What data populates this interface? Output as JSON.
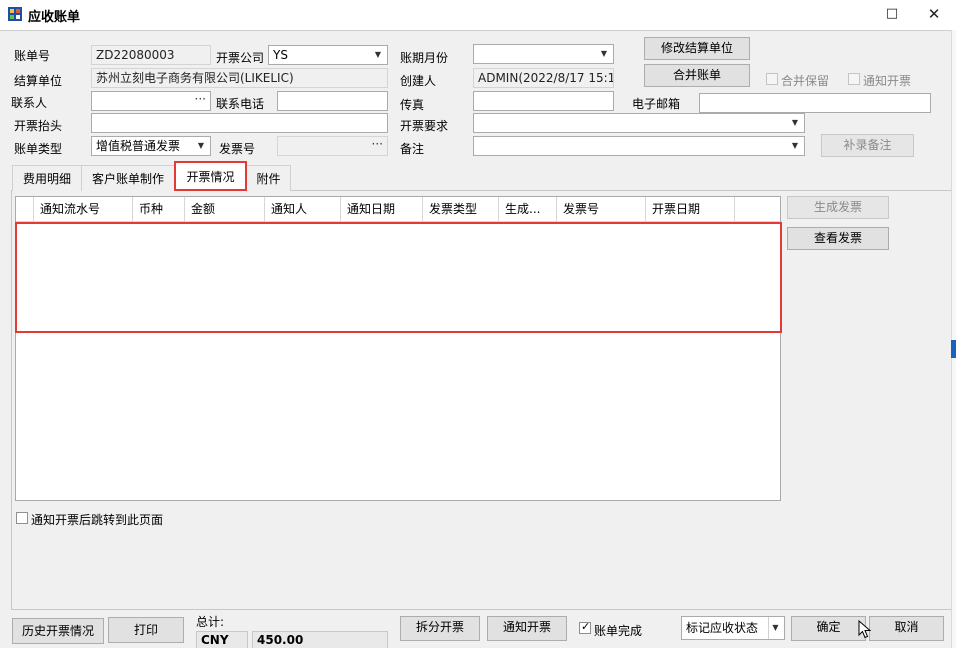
{
  "window": {
    "title": "应收账单",
    "maximize_icon": "□",
    "close_icon": "✕"
  },
  "form": {
    "bill_no": {
      "label": "账单号",
      "value": "ZD22080003"
    },
    "invoice_company": {
      "label": "开票公司",
      "value": "YS"
    },
    "period_month": {
      "label": "账期月份",
      "value": ""
    },
    "settle_unit": {
      "label": "结算单位",
      "value": "苏州立刻电子商务有限公司(LIKELIC)"
    },
    "creator": {
      "label": "创建人",
      "value": "ADMIN(2022/8/17 15:1"
    },
    "contact": {
      "label": "联系人",
      "value": ""
    },
    "phone": {
      "label": "联系电话",
      "value": ""
    },
    "fax": {
      "label": "传真",
      "value": ""
    },
    "email": {
      "label": "电子邮箱",
      "value": ""
    },
    "invoice_header": {
      "label": "开票抬头",
      "value": ""
    },
    "invoice_req": {
      "label": "开票要求",
      "value": ""
    },
    "bill_type": {
      "label": "账单类型",
      "value": "增值税普通发票"
    },
    "invoice_no": {
      "label": "发票号",
      "value": ""
    },
    "remark": {
      "label": "备注",
      "value": ""
    }
  },
  "buttons": {
    "modify_settle": "修改结算单位",
    "merge_bill": "合并账单",
    "supplement_remark": "补录备注",
    "generate_invoice": "生成发票",
    "view_invoice": "查看发票",
    "history_invoice": "历史开票情况",
    "print": "打印",
    "split_invoice": "拆分开票",
    "notify_invoice": "通知开票",
    "confirm": "确定",
    "cancel": "取消"
  },
  "checkboxes": {
    "merge_keep": {
      "label": "合并保留",
      "checked": false
    },
    "notify_invoice_top": {
      "label": "通知开票",
      "checked": false
    },
    "jump_after_notify": {
      "label": "通知开票后跳转到此页面",
      "checked": false
    },
    "bill_complete": {
      "label": "账单完成",
      "checked": true
    }
  },
  "tabs": [
    {
      "label": "费用明细",
      "active": false
    },
    {
      "label": "客户账单制作",
      "active": false
    },
    {
      "label": "开票情况",
      "active": true
    },
    {
      "label": "附件",
      "active": false
    }
  ],
  "grid": {
    "columns": [
      "通知流水号",
      "币种",
      "金额",
      "通知人",
      "通知日期",
      "发票类型",
      "生成...",
      "发票号",
      "开票日期"
    ],
    "rows": []
  },
  "summary": {
    "label": "总计:",
    "currency": "CNY",
    "amount": "450.00"
  },
  "status_select": {
    "value": "标记应收状态"
  },
  "colors": {
    "highlight": "#e53935",
    "accent": "#1565c0"
  }
}
